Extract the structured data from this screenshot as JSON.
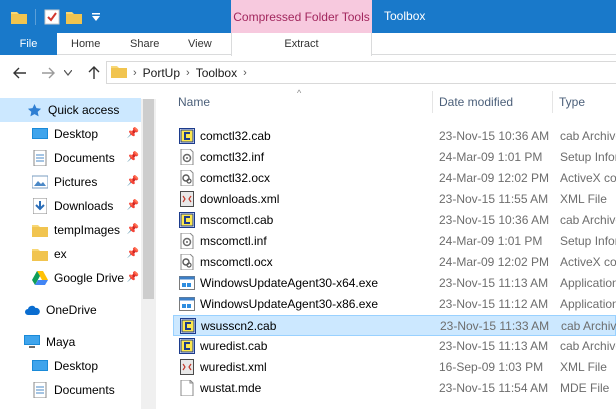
{
  "window": {
    "title": "Toolbox",
    "context_tab": "Compressed Folder Tools"
  },
  "ribbon": {
    "tabs": [
      "File",
      "Home",
      "Share",
      "View",
      "Extract"
    ]
  },
  "address": {
    "crumbs": [
      "PortUp",
      "Toolbox"
    ]
  },
  "nav": {
    "items": [
      {
        "label": "Quick access",
        "icon": "star-icon",
        "pinned": false
      },
      {
        "label": "Desktop",
        "icon": "desktop-icon",
        "pinned": true
      },
      {
        "label": "Documents",
        "icon": "documents-icon",
        "pinned": true
      },
      {
        "label": "Pictures",
        "icon": "pictures-icon",
        "pinned": true
      },
      {
        "label": "Downloads",
        "icon": "downloads-icon",
        "pinned": true
      },
      {
        "label": "tempImages",
        "icon": "folder-icon",
        "pinned": true
      },
      {
        "label": "ex",
        "icon": "folder-icon",
        "pinned": true
      },
      {
        "label": "Google Drive",
        "icon": "google-drive-icon",
        "pinned": true
      },
      {
        "label": "OneDrive",
        "icon": "onedrive-icon",
        "pinned": false
      },
      {
        "label": "Maya",
        "icon": "computer-icon",
        "pinned": false
      },
      {
        "label": "Desktop",
        "icon": "desktop-icon",
        "pinned": false
      },
      {
        "label": "Documents",
        "icon": "documents-icon",
        "pinned": false
      }
    ]
  },
  "columns": {
    "name": "Name",
    "date": "Date modified",
    "type": "Type"
  },
  "files": [
    {
      "name": "comctl32.cab",
      "date": "23-Nov-15 10:36 AM",
      "type": "cab Archive",
      "icon": "cab-icon"
    },
    {
      "name": "comctl32.inf",
      "date": "24-Mar-09 1:01 PM",
      "type": "Setup Information",
      "icon": "inf-icon"
    },
    {
      "name": "comctl32.ocx",
      "date": "24-Mar-09 12:02 PM",
      "type": "ActiveX control",
      "icon": "ocx-icon"
    },
    {
      "name": "downloads.xml",
      "date": "23-Nov-15 11:55 AM",
      "type": "XML File",
      "icon": "xml-icon"
    },
    {
      "name": "mscomctl.cab",
      "date": "23-Nov-15 10:36 AM",
      "type": "cab Archive",
      "icon": "cab-icon"
    },
    {
      "name": "mscomctl.inf",
      "date": "24-Mar-09 1:01 PM",
      "type": "Setup Information",
      "icon": "inf-icon"
    },
    {
      "name": "mscomctl.ocx",
      "date": "24-Mar-09 12:02 PM",
      "type": "ActiveX control",
      "icon": "ocx-icon"
    },
    {
      "name": "WindowsUpdateAgent30-x64.exe",
      "date": "23-Nov-15 11:13 AM",
      "type": "Application",
      "icon": "exe-icon"
    },
    {
      "name": "WindowsUpdateAgent30-x86.exe",
      "date": "23-Nov-15 11:12 AM",
      "type": "Application",
      "icon": "exe-icon"
    },
    {
      "name": "wsusscn2.cab",
      "date": "23-Nov-15 11:33 AM",
      "type": "cab Archive",
      "icon": "cab-icon",
      "selected": true
    },
    {
      "name": "wuredist.cab",
      "date": "23-Nov-15 11:13 AM",
      "type": "cab Archive",
      "icon": "cab-icon"
    },
    {
      "name": "wuredist.xml",
      "date": "16-Sep-09 1:03 PM",
      "type": "XML File",
      "icon": "xml-icon"
    },
    {
      "name": "wustat.mde",
      "date": "23-Nov-15 11:54 AM",
      "type": "MDE File",
      "icon": "mde-icon"
    }
  ],
  "colors": {
    "titlebar": "#1979ca",
    "context_tab_bg": "#f7c9de",
    "selection": "#cce8ff"
  }
}
